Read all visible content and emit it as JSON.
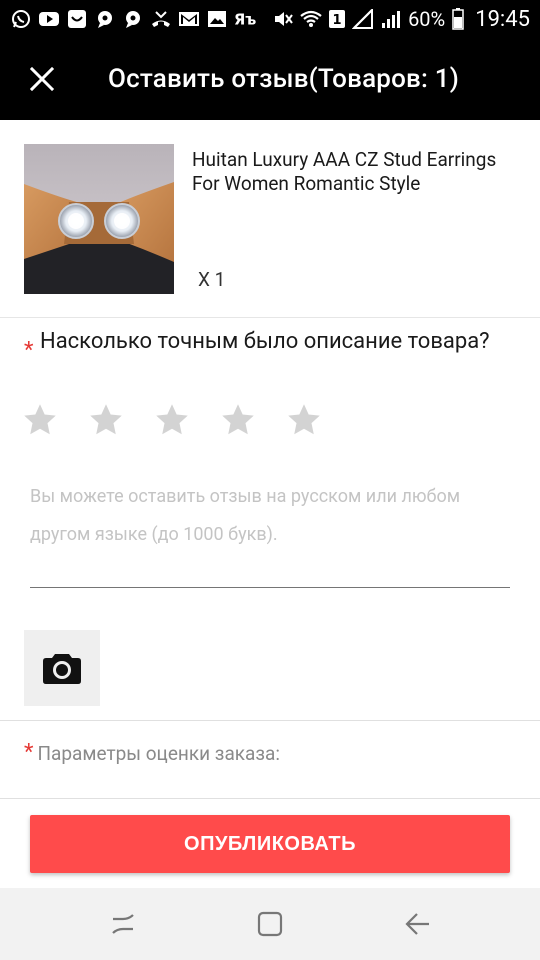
{
  "status_bar": {
    "battery": "60%",
    "time": "19:45",
    "sim": "1",
    "left_icons": [
      "whatsapp-icon",
      "youtube-icon",
      "aliexpress-icon",
      "chat-icon",
      "chat-icon",
      "missed-call-icon",
      "gmail-icon",
      "gallery-icon",
      "yandex-icon"
    ],
    "right_icons": [
      "mute-icon",
      "wifi-icon",
      "sim-icon",
      "no-signal-icon",
      "signal-icon",
      "battery-icon"
    ]
  },
  "app_bar": {
    "title": "Оставить отзыв(Товаров: 1)",
    "close_icon": "close-icon",
    "background": "#000000"
  },
  "product": {
    "title": "Huitan Luxury AAA CZ Stud Earrings For Women Romantic Style",
    "quantity": "X 1"
  },
  "question": {
    "required_mark": "*",
    "text": "Насколько точным было описание товара?",
    "rating": 0,
    "max_rating": 5,
    "star_color": "#d3d3d3"
  },
  "review": {
    "placeholder": "Вы можете оставить отзыв на русском или любом другом языке (до 1000 букв).",
    "value": ""
  },
  "photo": {
    "icon": "camera-icon"
  },
  "params": {
    "required_mark": "*",
    "label": "Параметры оценки заказа:"
  },
  "publish": {
    "label": "ОПУБЛИКОВАТЬ",
    "color": "#ff4b4b"
  },
  "nav_bar": {
    "icons": [
      "recent-apps-icon",
      "home-icon",
      "back-icon"
    ]
  }
}
